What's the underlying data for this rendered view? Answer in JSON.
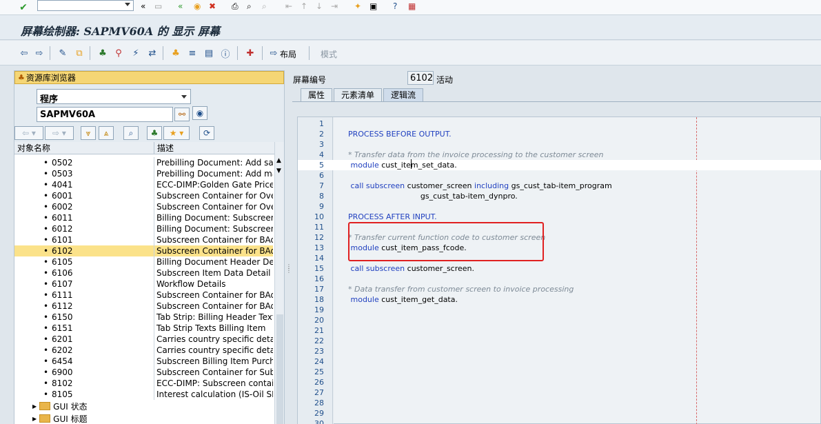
{
  "title": "屏幕绘制器: SAPMV60A 的 显示 屏幕",
  "toolbar": {
    "layout_label": "布局",
    "mode_label": "模式"
  },
  "left": {
    "repo_browser_label": "资源库浏览器",
    "object_type": "程序",
    "object_name": "SAPMV60A",
    "col_name": "对象名称",
    "col_desc": "描述",
    "rows": [
      {
        "id": "0502",
        "desc": "Prebilling Document: Add sales"
      },
      {
        "id": "0503",
        "desc": "Prebilling Document: Add manu"
      },
      {
        "id": "4041",
        "desc": "ECC-DIMP:Golden Gate Price Pr"
      },
      {
        "id": "6001",
        "desc": "Subscreen Container for Overvi"
      },
      {
        "id": "6002",
        "desc": "Subscreen Container for Overvi"
      },
      {
        "id": "6011",
        "desc": "Billing Document: Subscreen, G"
      },
      {
        "id": "6012",
        "desc": "Billing Document: Subscreen, G"
      },
      {
        "id": "6101",
        "desc": "Subscreen Container for BAdI L"
      },
      {
        "id": "6102",
        "desc": "Subscreen Container for BAdI L"
      },
      {
        "id": "6105",
        "desc": "Billing Document Header Detail"
      },
      {
        "id": "6106",
        "desc": "Subscreen Item Data Detail"
      },
      {
        "id": "6107",
        "desc": "Workflow Details"
      },
      {
        "id": "6111",
        "desc": "Subscreen Container for BAdI L"
      },
      {
        "id": "6112",
        "desc": "Subscreen Container for BAdI L"
      },
      {
        "id": "6150",
        "desc": "Tab Strip: Billing Header Texts"
      },
      {
        "id": "6151",
        "desc": "Tab Strip Texts Billing Item"
      },
      {
        "id": "6201",
        "desc": "Carries country specific detail sc"
      },
      {
        "id": "6202",
        "desc": "Carries country specific detail sc"
      },
      {
        "id": "6454",
        "desc": "Subscreen Billing Item Purchasir"
      },
      {
        "id": "6900",
        "desc": "Subscreen Container for Subscr"
      },
      {
        "id": "8102",
        "desc": "ECC-DIMP: Subscreen container"
      },
      {
        "id": "8105",
        "desc": "Interest calculation (IS-Oil SDP"
      }
    ],
    "folders": [
      "GUI 状态",
      "GUI 标题"
    ]
  },
  "right": {
    "screen_no_label": "屏幕编号",
    "screen_no": "6102",
    "status": "活动",
    "tabs": [
      "属性",
      "元素清单",
      "逻辑流"
    ],
    "code_lines": [
      {
        "n": "1",
        "parts": []
      },
      {
        "n": "2",
        "parts": [
          {
            "t": "PROCESS BEFORE OUTPUT.",
            "c": "kw"
          }
        ]
      },
      {
        "n": "3",
        "parts": []
      },
      {
        "n": "4",
        "parts": [
          {
            "t": "* Transfer data from the invoice processing to the customer screen",
            "c": "cm"
          }
        ]
      },
      {
        "n": "5",
        "parts": [
          {
            "t": " module",
            "c": "kw"
          },
          {
            "t": " cust_item_set_data.",
            "c": "tx"
          }
        ]
      },
      {
        "n": "6",
        "parts": []
      },
      {
        "n": "7",
        "parts": [
          {
            "t": " call subscreen",
            "c": "kw"
          },
          {
            "t": " customer_screen ",
            "c": "tx"
          },
          {
            "t": "including",
            "c": "kw"
          },
          {
            "t": " gs_cust_tab-item_program",
            "c": "tx"
          }
        ]
      },
      {
        "n": "8",
        "parts": [
          {
            "t": "                              gs_cust_tab-item_dynpro.",
            "c": "tx"
          }
        ]
      },
      {
        "n": "9",
        "parts": []
      },
      {
        "n": "10",
        "parts": [
          {
            "t": "PROCESS AFTER INPUT.",
            "c": "kw"
          }
        ]
      },
      {
        "n": "11",
        "parts": []
      },
      {
        "n": "12",
        "parts": [
          {
            "t": "* Transfer current function code to customer screen",
            "c": "cm"
          }
        ]
      },
      {
        "n": "13",
        "parts": [
          {
            "t": " module",
            "c": "kw"
          },
          {
            "t": " cust_item_pass_fcode.",
            "c": "tx"
          }
        ]
      },
      {
        "n": "14",
        "parts": []
      },
      {
        "n": "15",
        "parts": [
          {
            "t": " call subscreen",
            "c": "kw"
          },
          {
            "t": " customer_screen.",
            "c": "tx"
          }
        ]
      },
      {
        "n": "16",
        "parts": []
      },
      {
        "n": "17",
        "parts": [
          {
            "t": "* Data transfer from customer screen to invoice processing",
            "c": "cm"
          }
        ]
      },
      {
        "n": "18",
        "parts": [
          {
            "t": " module",
            "c": "kw"
          },
          {
            "t": " cust_item_get_data.",
            "c": "tx"
          }
        ]
      },
      {
        "n": "19",
        "parts": []
      },
      {
        "n": "20",
        "parts": []
      },
      {
        "n": "21",
        "parts": []
      },
      {
        "n": "22",
        "parts": []
      },
      {
        "n": "23",
        "parts": []
      },
      {
        "n": "24",
        "parts": []
      },
      {
        "n": "25",
        "parts": []
      },
      {
        "n": "26",
        "parts": []
      },
      {
        "n": "27",
        "parts": []
      },
      {
        "n": "28",
        "parts": []
      },
      {
        "n": "29",
        "parts": []
      },
      {
        "n": "30",
        "parts": []
      }
    ]
  },
  "selected_row": "6102",
  "current_line": "5",
  "colors": {
    "selection": "#fbe28a",
    "keyword": "#1f3fbf",
    "comment": "#7d8a96",
    "highlight": "#e02020"
  }
}
